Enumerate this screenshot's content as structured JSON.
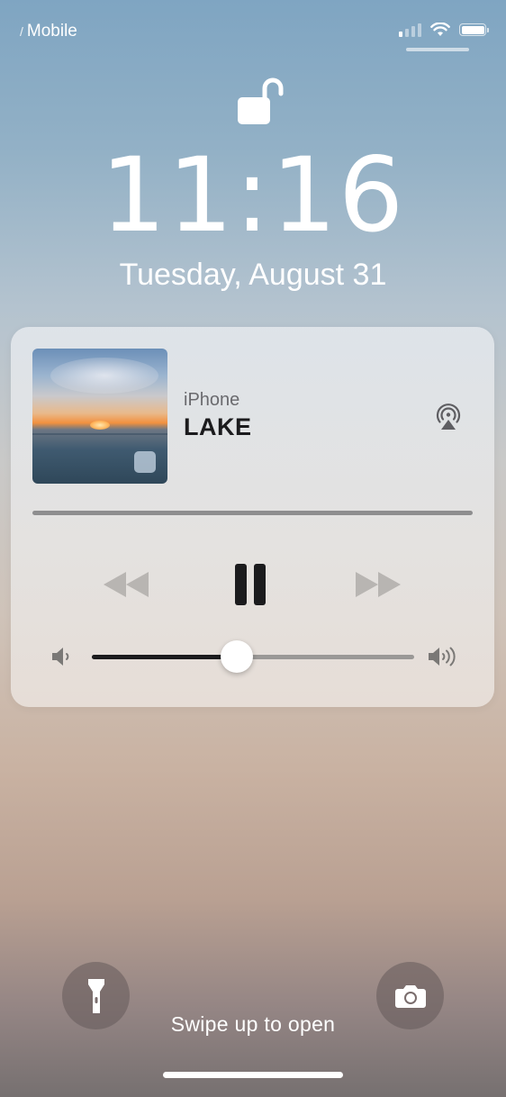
{
  "status_bar": {
    "carrier": "Mobile",
    "signal_bars_active": 1,
    "signal_bars_total": 4,
    "battery_level": 1.0
  },
  "lock_screen": {
    "time": "11:16",
    "date": "Tuesday, August 31"
  },
  "now_playing": {
    "source": "iPhone",
    "title": "LAKE",
    "volume_level": 0.45,
    "playback_state": "playing"
  },
  "bottom": {
    "swipe_hint": "Swipe up to open"
  },
  "icons": {
    "lock": "unlocked-padlock-icon",
    "airplay": "airplay-icon",
    "rewind": "rewind-icon",
    "pause": "pause-icon",
    "forward": "fast-forward-icon",
    "volume_low": "volume-low-icon",
    "volume_high": "volume-high-icon",
    "flashlight": "flashlight-icon",
    "camera": "camera-icon"
  }
}
